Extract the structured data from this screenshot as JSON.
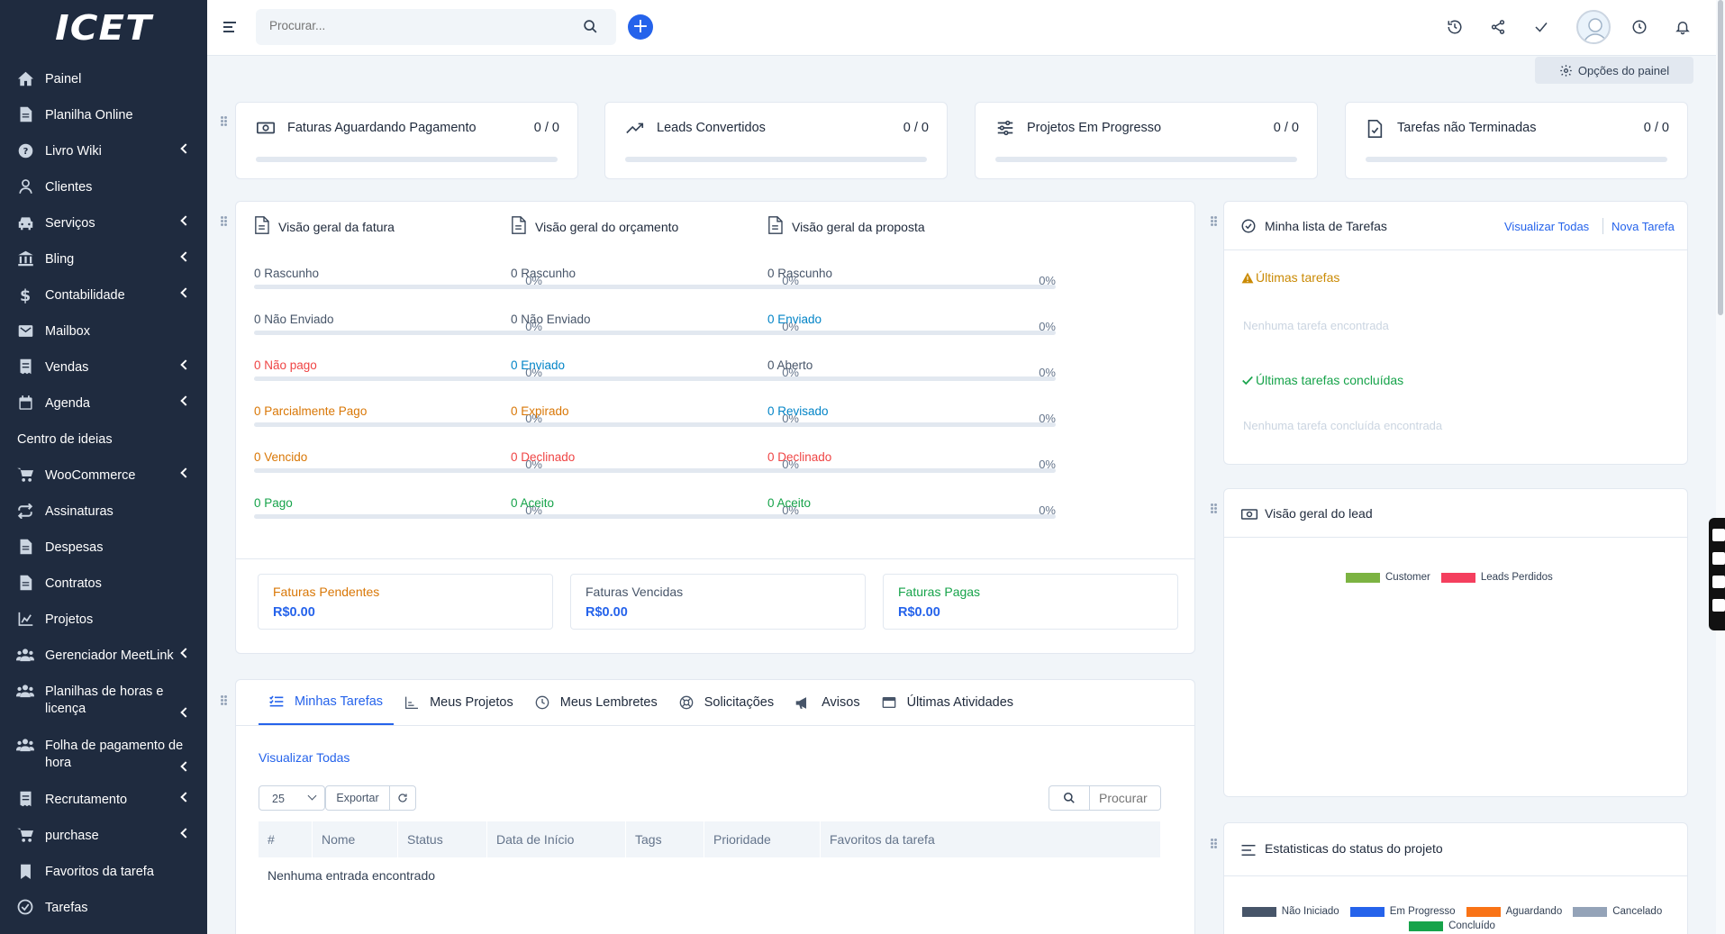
{
  "brand": "ICET",
  "sidebar": {
    "items": [
      {
        "label": "Painel",
        "icon": "home-icon",
        "chevron": false
      },
      {
        "label": "Planilha Online",
        "icon": "file-icon",
        "chevron": false
      },
      {
        "label": "Livro Wiki",
        "icon": "question-icon",
        "chevron": true
      },
      {
        "label": "Clientes",
        "icon": "user-icon",
        "chevron": false
      },
      {
        "label": "Serviços",
        "icon": "car-icon",
        "chevron": true
      },
      {
        "label": "Bling",
        "icon": "bank-icon",
        "chevron": true
      },
      {
        "label": "Contabilidade",
        "icon": "dollar-icon",
        "chevron": true
      },
      {
        "label": "Mailbox",
        "icon": "mail-icon",
        "chevron": false
      },
      {
        "label": "Vendas",
        "icon": "receipt-icon",
        "chevron": true
      },
      {
        "label": "Agenda",
        "icon": "calendar-icon",
        "chevron": true
      },
      {
        "label": "Centro de ideias",
        "icon": "",
        "chevron": false
      },
      {
        "label": "WooCommerce",
        "icon": "cart-icon",
        "chevron": true
      },
      {
        "label": "Assinaturas",
        "icon": "repeat-icon",
        "chevron": false
      },
      {
        "label": "Despesas",
        "icon": "file-icon",
        "chevron": false
      },
      {
        "label": "Contratos",
        "icon": "file-icon",
        "chevron": false
      },
      {
        "label": "Projetos",
        "icon": "chart-icon",
        "chevron": false
      },
      {
        "label": "Gerenciador MeetLink",
        "icon": "users-icon",
        "chevron": true
      },
      {
        "label": "Planilhas de horas e licença",
        "icon": "users-icon",
        "chevron": true,
        "multi": true
      },
      {
        "label": "Folha de pagamento de hora",
        "icon": "users-icon",
        "chevron": true,
        "multi": true
      },
      {
        "label": "Recrutamento",
        "icon": "receipt-icon",
        "chevron": true
      },
      {
        "label": "purchase",
        "icon": "cart-icon",
        "chevron": true
      },
      {
        "label": "Favoritos da tarefa",
        "icon": "bookmark-icon",
        "chevron": false
      },
      {
        "label": "Tarefas",
        "icon": "check-circle-icon",
        "chevron": false
      }
    ]
  },
  "topbar": {
    "search_placeholder": "Procurar...",
    "icons": [
      "history-icon",
      "share-icon",
      "check-icon",
      "clock-icon",
      "bell-icon"
    ]
  },
  "dashboard_options": "Opções do painel",
  "stats": [
    {
      "title": "Faturas Aguardando Pagamento",
      "value": "0 / 0",
      "icon": "money-icon"
    },
    {
      "title": "Leads Convertidos",
      "value": "0 / 0",
      "icon": "trend-icon"
    },
    {
      "title": "Projetos Em Progresso",
      "value": "0 / 0",
      "icon": "sliders-icon"
    },
    {
      "title": "Tarefas não Terminadas",
      "value": "0 / 0",
      "icon": "file-check-icon"
    }
  ],
  "overview": [
    {
      "title": "Visão geral da fatura",
      "rows": [
        {
          "label": "0 Rascunho",
          "pct": "0%",
          "color": "gray"
        },
        {
          "label": "0 Não Enviado",
          "pct": "0%",
          "color": "gray"
        },
        {
          "label": "0 Não pago",
          "pct": "0%",
          "color": "red"
        },
        {
          "label": "0 Parcialmente Pago",
          "pct": "0%",
          "color": "orange"
        },
        {
          "label": "0 Vencido",
          "pct": "0%",
          "color": "orange"
        },
        {
          "label": "0 Pago",
          "pct": "0%",
          "color": "green"
        }
      ]
    },
    {
      "title": "Visão geral do orçamento",
      "rows": [
        {
          "label": "0 Rascunho",
          "pct": "0%",
          "color": "gray"
        },
        {
          "label": "0 Não Enviado",
          "pct": "0%",
          "color": "gray"
        },
        {
          "label": "0 Enviado",
          "pct": "0%",
          "color": "blue"
        },
        {
          "label": "0 Expirado",
          "pct": "0%",
          "color": "orange"
        },
        {
          "label": "0 Declinado",
          "pct": "0%",
          "color": "red"
        },
        {
          "label": "0 Aceito",
          "pct": "0%",
          "color": "green"
        }
      ]
    },
    {
      "title": "Visão geral da proposta",
      "rows": [
        {
          "label": "0 Rascunho",
          "pct": "0%",
          "color": "gray"
        },
        {
          "label": "0 Enviado",
          "pct": "0%",
          "color": "blue"
        },
        {
          "label": "0 Aberto",
          "pct": "0%",
          "color": "gray"
        },
        {
          "label": "0 Revisado",
          "pct": "0%",
          "color": "blue"
        },
        {
          "label": "0 Declinado",
          "pct": "0%",
          "color": "red"
        },
        {
          "label": "0 Aceito",
          "pct": "0%",
          "color": "green"
        }
      ]
    }
  ],
  "totals": [
    {
      "label": "Faturas Pendentes",
      "value": "R$0.00",
      "color": "orange"
    },
    {
      "label": "Faturas Vencidas",
      "value": "R$0.00",
      "color": "gray"
    },
    {
      "label": "Faturas Pagas",
      "value": "R$0.00",
      "color": "green"
    }
  ],
  "tasks_widget": {
    "title": "Minha lista de Tarefas",
    "view_all": "Visualizar Todas",
    "new_task": "Nova Tarefa",
    "latest_title": "Últimas tarefas",
    "latest_empty": "Nenhuma tarefa encontrada",
    "done_title": "Últimas tarefas concluídas",
    "done_empty": "Nenhuma tarefa concluída encontrada"
  },
  "lead_widget": {
    "title": "Visão geral do lead",
    "legend": [
      {
        "label": "Customer",
        "color": "#7cb342"
      },
      {
        "label": "Leads Perdidos",
        "color": "#f43f5e"
      }
    ]
  },
  "project_status_widget": {
    "title": "Estatisticas do status do projeto",
    "legend": [
      {
        "label": "Não Iniciado",
        "color": "#475569"
      },
      {
        "label": "Em Progresso",
        "color": "#2563eb"
      },
      {
        "label": "Aguardando",
        "color": "#f97316"
      },
      {
        "label": "Cancelado",
        "color": "#94a3b8"
      },
      {
        "label": "Concluído",
        "color": "#16a34a"
      }
    ]
  },
  "tabs_section": {
    "tabs": [
      {
        "label": "Minhas Tarefas",
        "icon": "list-icon",
        "active": true
      },
      {
        "label": "Meus Projetos",
        "icon": "chart-icon",
        "active": false
      },
      {
        "label": "Meus Lembretes",
        "icon": "clock-icon",
        "active": false
      },
      {
        "label": "Solicitações",
        "icon": "lifebuoy-icon",
        "active": false
      },
      {
        "label": "Avisos",
        "icon": "megaphone-icon",
        "active": false
      },
      {
        "label": "Últimas Atividades",
        "icon": "window-icon",
        "active": false
      }
    ],
    "view_all": "Visualizar Todas",
    "page_size": "25",
    "export": "Exportar",
    "search_placeholder": "Procurar",
    "columns": [
      "#",
      "Nome",
      "Status",
      "Data de Início",
      "Tags",
      "Prioridade",
      "Favoritos da tarefa"
    ],
    "empty": "Nenhuma entrada encontrado"
  }
}
